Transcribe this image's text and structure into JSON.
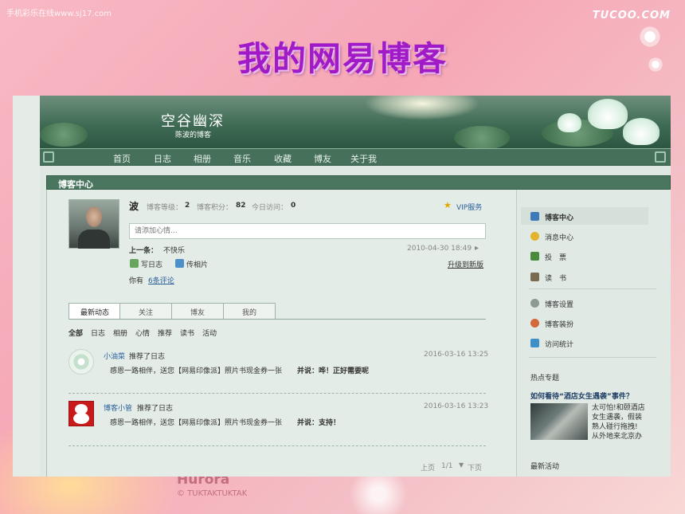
{
  "slide": {
    "watermark_top": "手机彩乐在线www.sj17.com",
    "logo_top_right": "TUCOO.COM",
    "title": "我的网易博客",
    "bottom_logo": "Hurora",
    "bottom_sub": "© TUKTAKTUKTAK"
  },
  "blog": {
    "title": "空谷幽深",
    "subtitle": "陈波的博客",
    "nav": [
      "首页",
      "日志",
      "相册",
      "音乐",
      "收藏",
      "博友",
      "关于我"
    ]
  },
  "panel": {
    "title": "博客中心"
  },
  "profile": {
    "name": "波",
    "level_label": "博客等级：",
    "level_value": "2",
    "points_label": "博客积分：",
    "points_value": "82",
    "visits_label": "今日访问：",
    "visits_value": "0",
    "vip": "VIP服务",
    "mood_placeholder": "请添加心情...",
    "prev_label": "上一条：",
    "prev_text": "不快乐",
    "prev_time": "2010-04-30 18:49",
    "write_log": "写日志",
    "upload_photo": "传相片",
    "upgrade": "升级到新版",
    "comments_prefix": "你有",
    "comments_link": "6条评论"
  },
  "tabs": [
    "最新动态",
    "关注",
    "博友",
    "我的"
  ],
  "filters": [
    "全部",
    "日志",
    "相册",
    "心情",
    "推荐",
    "读书",
    "活动"
  ],
  "feed": [
    {
      "user": "小油菜",
      "action": "推荐了日志",
      "time": "2016-03-16 13:25",
      "content": "感恩一路相伴，送您【网易印像派】照片书现金券一张",
      "note": "并说：哗！正好需要呢"
    },
    {
      "user": "博客小管",
      "action": "推荐了日志",
      "time": "2016-03-16 13:23",
      "content": "感恩一路相伴，送您【网易印像派】照片书现金券一张",
      "note": "并说：支持！"
    }
  ],
  "pager": {
    "prev": "上页",
    "page": "1/1",
    "next": "下页"
  },
  "sidebar": {
    "menu": [
      "博客中心",
      "消息中心",
      "投　票",
      "读　书"
    ],
    "menu2": [
      "博客设置",
      "博客装扮",
      "访问统计"
    ],
    "hot_label": "热点专题",
    "hot_title": "如何看待“酒店女生遇袭”事件？",
    "hot_lines": [
      "太可怕!和颐酒店",
      "女生遇袭，假装",
      "熟人碰行拖拽!",
      "从外地来北京办"
    ],
    "latest_label": "最新活动"
  },
  "colors": {
    "title_purple": "#a01ac8",
    "header_green": "#4a7660",
    "link_blue": "#2b5f9a"
  }
}
